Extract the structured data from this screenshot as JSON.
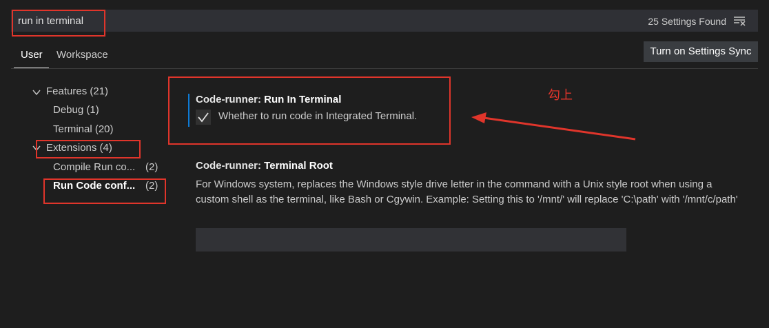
{
  "search": {
    "value": "run in terminal",
    "results_count": "25 Settings Found"
  },
  "tabs": [
    {
      "label": "User"
    },
    {
      "label": "Workspace"
    }
  ],
  "sync_button": {
    "label": "Turn on Settings Sync"
  },
  "tree": {
    "features": {
      "label": "Features (21)",
      "children": [
        {
          "label": "Debug (1)"
        },
        {
          "label": "Terminal (20)"
        }
      ]
    },
    "extensions": {
      "label": "Extensions (4)",
      "children": [
        {
          "label": "Compile Run co...",
          "count": "(2)"
        },
        {
          "label": "Run Code conf...",
          "count": "(2)"
        }
      ]
    }
  },
  "settings": [
    {
      "prefix": "Code-runner: ",
      "name": "Run In Terminal",
      "description": "Whether to run code in Integrated Terminal.",
      "checked": true
    },
    {
      "prefix": "Code-runner: ",
      "name": "Terminal Root",
      "description": "For Windows system, replaces the Windows style drive letter in the command with a Unix style root when using a custom shell as the terminal, like Bash or Cgywin. Example: Setting this to '/mnt/' will replace 'C:\\path' with '/mnt/c/path'",
      "value": ""
    }
  ],
  "annotation": {
    "text": "勾上"
  },
  "colors": {
    "accent": "#0e7ad4",
    "annotation": "#e0352b",
    "background": "#1e1e1e"
  },
  "icons": {
    "filter": "clear-filter-icon",
    "chevron": "chevron-down-icon",
    "check": "check-icon"
  }
}
